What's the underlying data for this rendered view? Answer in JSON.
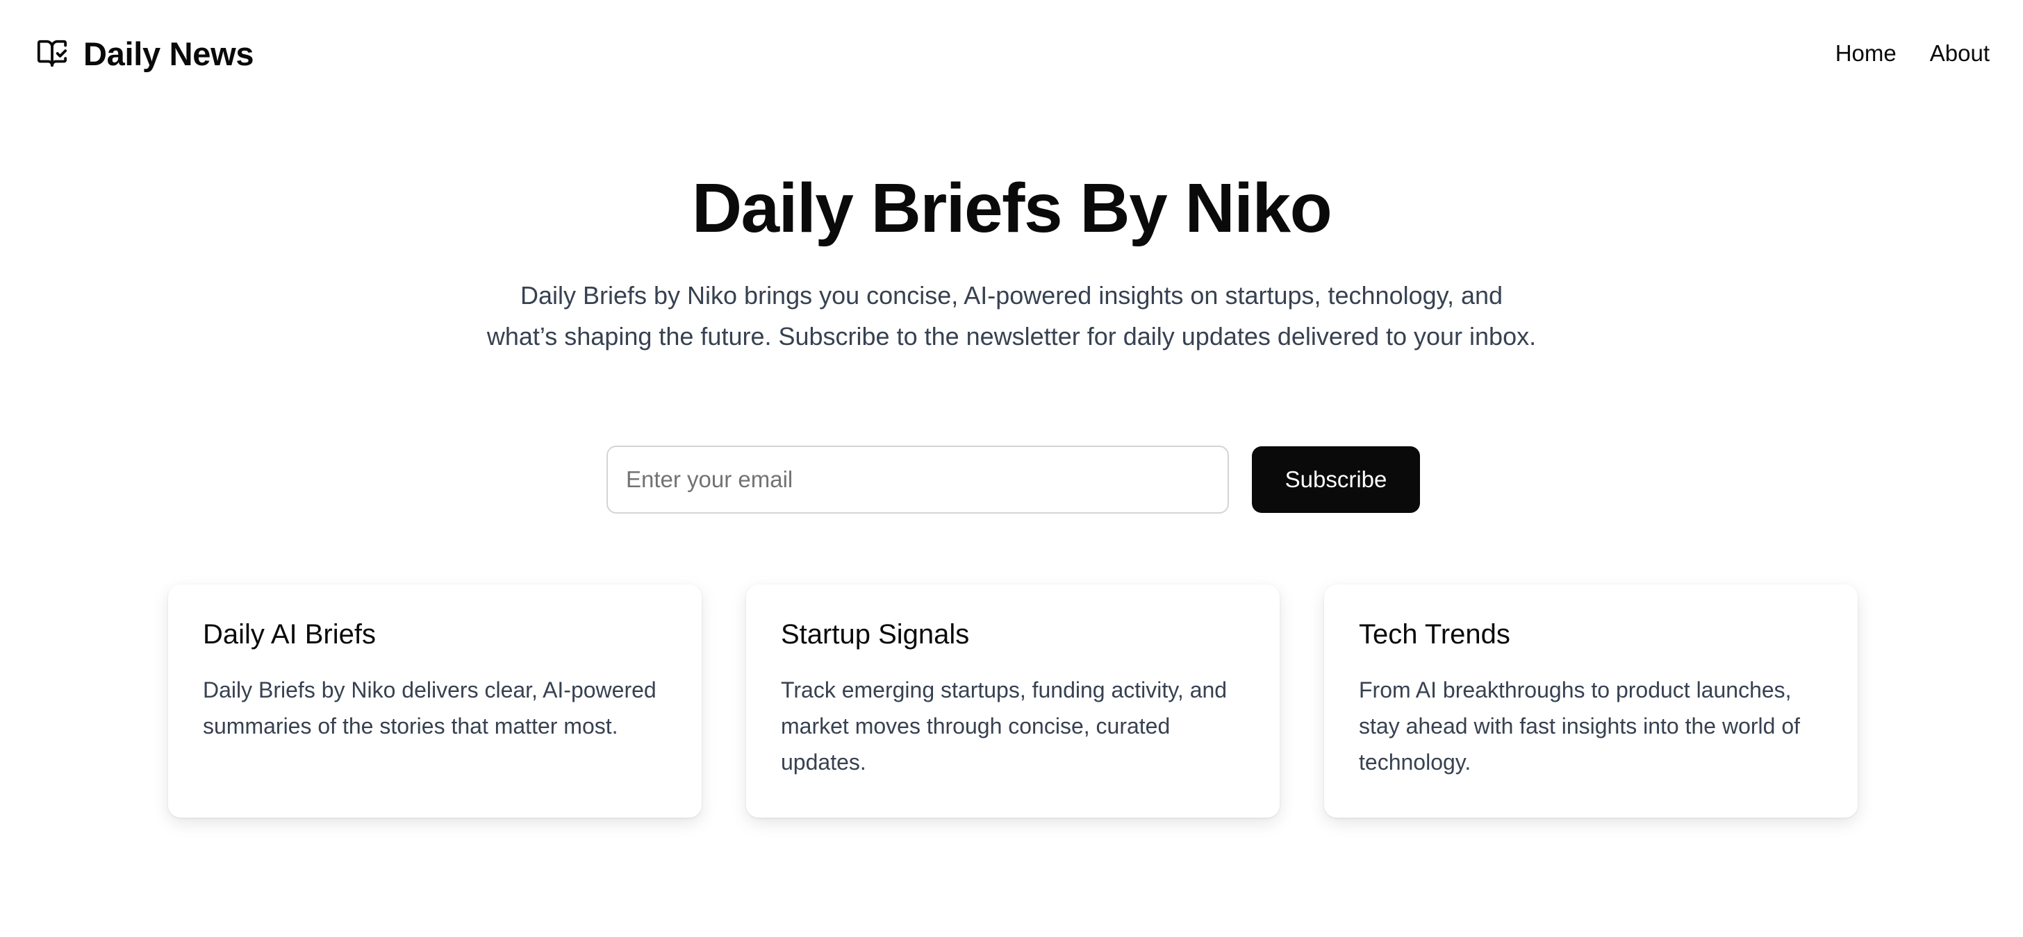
{
  "header": {
    "brand_name": "Daily News",
    "brand_icon": "book-open-check-icon",
    "nav": [
      {
        "label": "Home"
      },
      {
        "label": "About"
      }
    ]
  },
  "hero": {
    "title": "Daily Briefs By Niko",
    "description_line1": "Daily Briefs by Niko brings you concise, AI-powered insights on startups, technology, and",
    "description_line2": "what’s shaping the future. Subscribe to the newsletter for daily updates delivered to your inbox."
  },
  "subscribe": {
    "email_value": "",
    "email_placeholder": "Enter your email",
    "button_label": "Subscribe"
  },
  "cards": [
    {
      "title": "Daily AI Briefs",
      "text": "Daily Briefs by Niko delivers clear, AI-powered summaries of the stories that matter most."
    },
    {
      "title": "Startup Signals",
      "text": "Track emerging startups, funding activity, and market moves through concise, curated updates."
    },
    {
      "title": "Tech Trends",
      "text": "From AI breakthroughs to product launches, stay ahead with fast insights into the world of technology."
    }
  ],
  "colors": {
    "text_primary": "#0a0a0a",
    "text_secondary": "#374151",
    "button_bg": "#0a0a0a",
    "input_border": "#d4d4d8",
    "placeholder": "#737373"
  }
}
